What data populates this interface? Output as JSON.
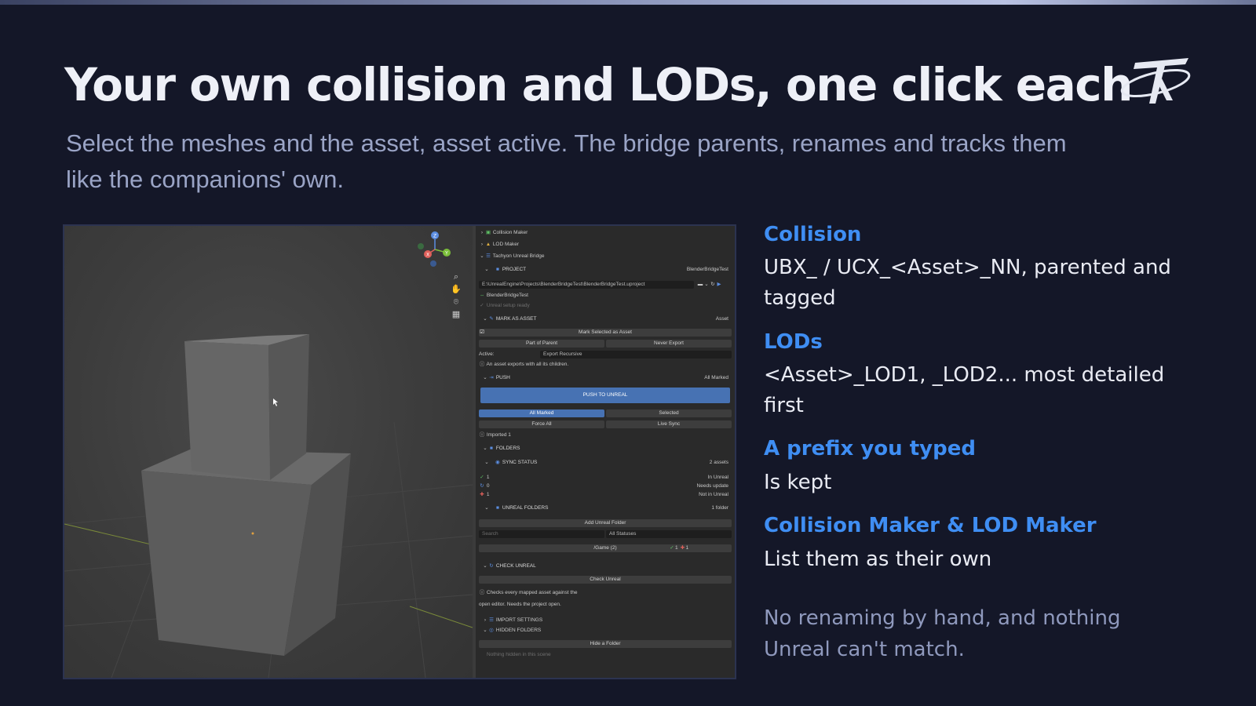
{
  "slide": {
    "title": "Your own collision and LODs, one click each",
    "subtitle": "Select the meshes and the asset, asset active. The bridge parents, renames and tracks them like the companions' own.",
    "accent_color": "#3f8ef3",
    "logo_icon": "tachyon-logo-icon"
  },
  "features": [
    {
      "title": "Collision",
      "text": "UBX_ / UCX_<Asset>_NN, parented and tagged"
    },
    {
      "title": "LODs",
      "text": "<Asset>_LOD1, _LOD2... most detailed first"
    },
    {
      "title": "A prefix you typed",
      "text": "Is kept"
    },
    {
      "title": "Collision Maker & LOD Maker",
      "text": "List them as their own"
    }
  ],
  "note": "No renaming by hand, and nothing Unreal can't match.",
  "screenshot": {
    "gizmo": {
      "x": "X",
      "y": "Y",
      "z": "Z"
    },
    "panel": {
      "collision_maker": "Collision Maker",
      "lod_maker": "LOD Maker",
      "bridge": "Tachyon Unreal Bridge",
      "project_label": "PROJECT",
      "project_name": "BlenderBridgeTest",
      "project_path": "E:\\UnrealEngine\\Projects\\BlenderBridgeTest\\BlenderBridgeTest.uproject",
      "project_link": "BlenderBridgeTest",
      "unreal_ready": "Unreal setup ready",
      "mark_as_asset": "MARK AS ASSET",
      "asset_label": "Asset",
      "mark_selected": "Mark Selected as Asset",
      "part_of_parent": "Part of Parent",
      "never_export": "Never Export",
      "active_label": "Active:",
      "export_mode": "Export Recursive",
      "asset_exports_info": "An asset exports with all its children.",
      "push_label": "PUSH",
      "all_marked_right": "All Marked",
      "push_button": "PUSH TO UNREAL",
      "tab_all_marked": "All Marked",
      "tab_selected": "Selected",
      "force_all": "Force All",
      "live_sync": "Live Sync",
      "imported": "Imported 1",
      "folders": "FOLDERS",
      "sync_status": "SYNC STATUS",
      "assets_count": "2 assets",
      "status_rows": [
        {
          "count": "1",
          "label": "In Unreal"
        },
        {
          "count": "0",
          "label": "Needs update"
        },
        {
          "count": "1",
          "label": "Not in Unreal"
        }
      ],
      "unreal_folders": "UNREAL FOLDERS",
      "folder_count": "1 folder",
      "add_folder": "Add Unreal Folder",
      "search_placeholder": "Search",
      "all_statuses": "All Statuses",
      "game_path": "/Game  (2)",
      "game_ok_count": "1",
      "game_missing_count": "1",
      "check_unreal_label": "CHECK UNREAL",
      "check_unreal_button": "Check Unreal",
      "check_info_1": "Checks every mapped asset against the",
      "check_info_2": "open editor. Needs the project open.",
      "import_settings": "IMPORT SETTINGS",
      "hidden_folders": "HIDDEN FOLDERS",
      "hide_folder": "Hide a Folder",
      "nothing_hidden": "Nothing hidden in this scene"
    }
  }
}
